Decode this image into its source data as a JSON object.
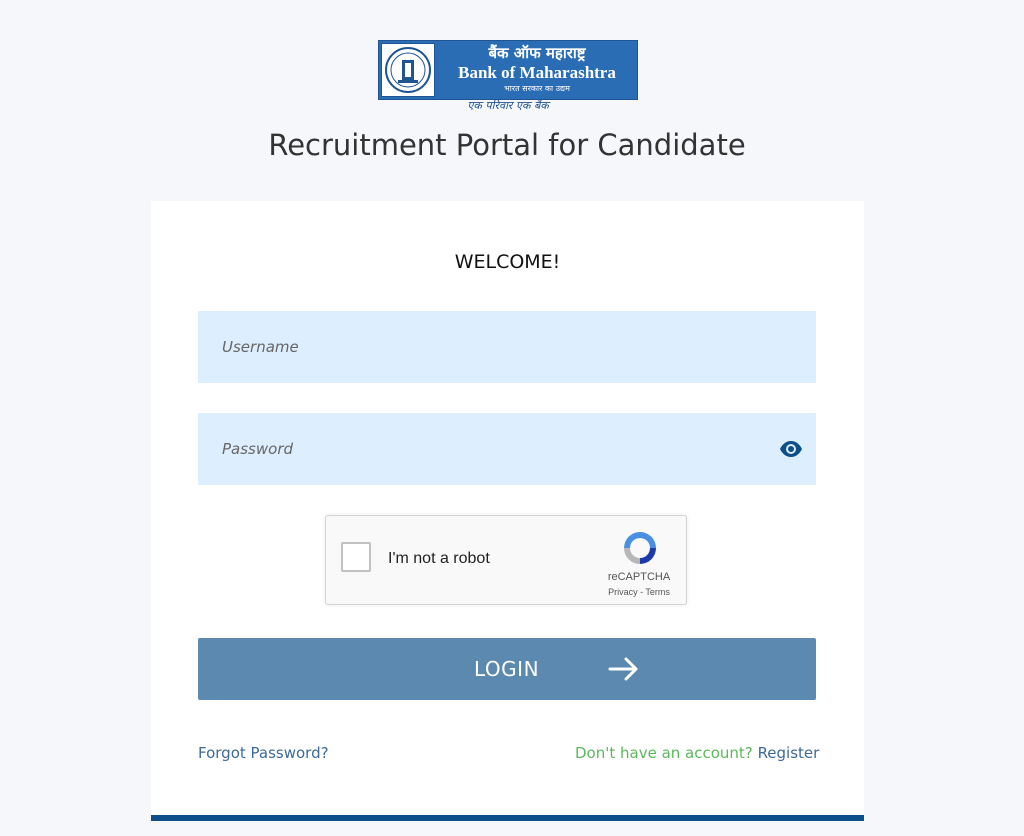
{
  "logo": {
    "hindi_name": "बैंक ऑफ महाराष्ट्र",
    "english_name": "Bank of Maharashtra",
    "subtitle": "भारत सरकार का उद्यम",
    "tagline": "एक परिवार एक बैंक"
  },
  "page_title": "Recruitment Portal for Candidate",
  "welcome": "WELCOME!",
  "username": {
    "placeholder": "Username",
    "value": ""
  },
  "password": {
    "placeholder": "Password",
    "value": ""
  },
  "captcha": {
    "label": "I'm not a robot",
    "brand": "reCAPTCHA",
    "links": "Privacy - Terms"
  },
  "login_button": "LOGIN",
  "forgot_password": "Forgot Password?",
  "no_account": "Don't have an account?",
  "register": "Register",
  "colors": {
    "page_bg": "#f5f7fa",
    "field_bg": "#ddeeff",
    "button": "#5b89b0",
    "link": "#3d6a98",
    "green_text": "#5cb85c",
    "card_border": "#0d4f8b"
  },
  "icons": [
    "bank-emblem-icon",
    "eye-icon",
    "recaptcha-icon",
    "arrow-right-icon"
  ]
}
